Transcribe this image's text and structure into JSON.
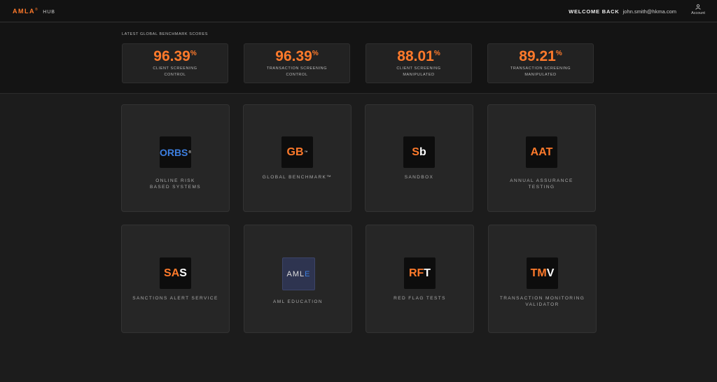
{
  "header": {
    "brand_name": "AMLA",
    "brand_mark": "®",
    "brand_suffix": "HUB",
    "welcome_label": "WELCOME BACK",
    "user_email": "john.smith@hkma.com",
    "account_label": "Account",
    "account_icon": "user-icon"
  },
  "benchmark": {
    "title": "LATEST GLOBAL BENCHMARK SCORES",
    "scores": [
      {
        "value": "96.39",
        "unit": "%",
        "label": "CLIENT SCREENING\nCONTROL"
      },
      {
        "value": "96.39",
        "unit": "%",
        "label": "TRANSACTION SCREENING\nCONTROL"
      },
      {
        "value": "88.01",
        "unit": "%",
        "label": "CLIENT SCREENING\nMANIPULATED"
      },
      {
        "value": "89.21",
        "unit": "%",
        "label": "TRANSACTION SCREENING\nMANIPULATED"
      }
    ]
  },
  "apps": [
    {
      "logo_a": "ORBS",
      "logo_tm": "®",
      "label": "ONLINE RISK\nBASED SYSTEMS"
    },
    {
      "logo_a": "GB",
      "logo_tm": "™",
      "label": "GLOBAL BENCHMARK™"
    },
    {
      "logo_a": "S",
      "logo_b": "b",
      "label": "SANDBOX"
    },
    {
      "logo_a": "AAT",
      "label": "ANNUAL ASSURANCE\nTESTING"
    },
    {
      "logo_a": "SA",
      "logo_b": "S",
      "label": "SANCTIONS ALERT SERVICE"
    },
    {
      "logo_a": "AML",
      "logo_b": "E",
      "label": "AML EDUCATION"
    },
    {
      "logo_a": "RF",
      "logo_b": "T",
      "label": "RED FLAG TESTS"
    },
    {
      "logo_a": "TM",
      "logo_b": "V",
      "label": "TRANSACTION MONITORING\nVALIDATOR"
    }
  ],
  "colors": {
    "accent": "#ff7a2b",
    "blue": "#3d7fe0",
    "background": "#1c1c1c",
    "tile": "#262626"
  }
}
